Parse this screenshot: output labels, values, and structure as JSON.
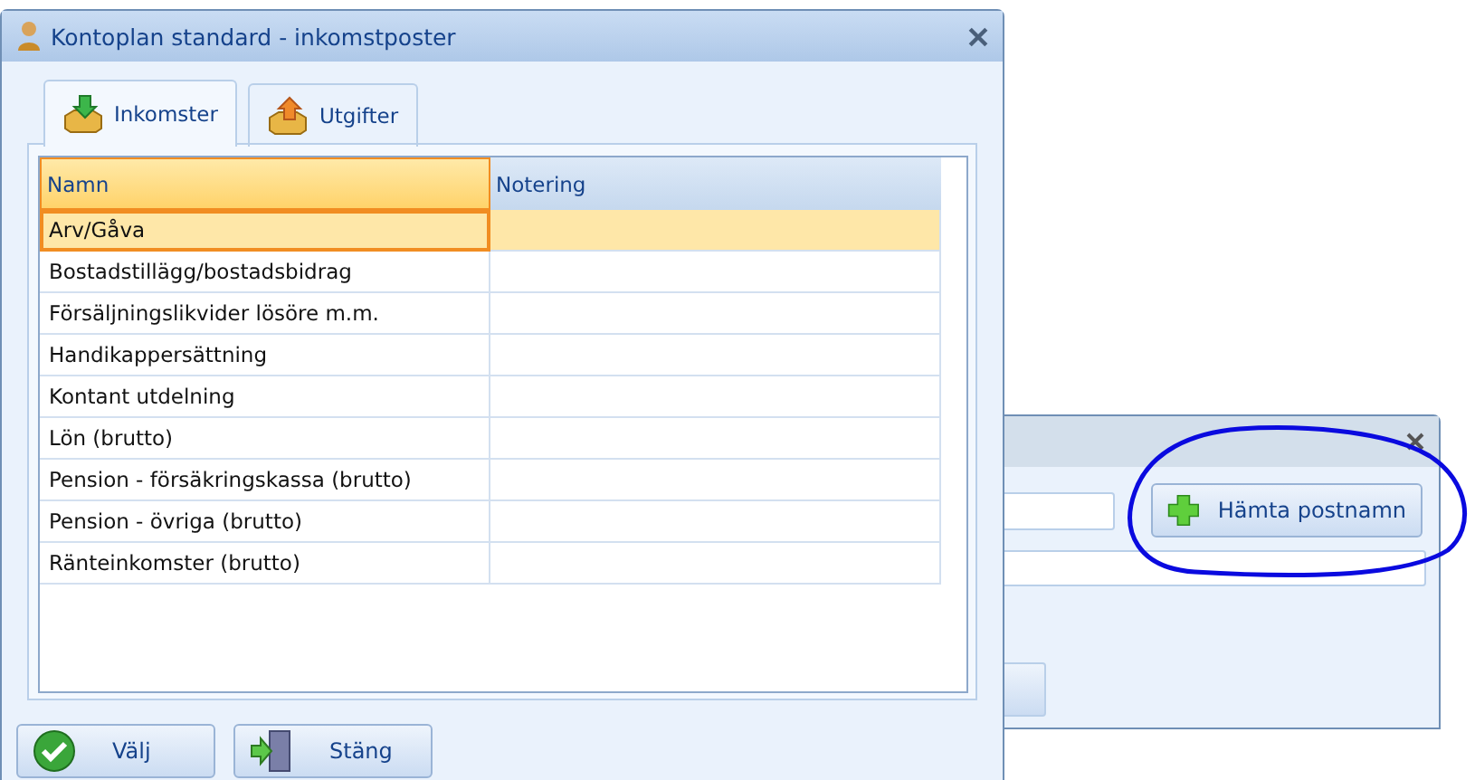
{
  "dialog": {
    "title": "Kontoplan standard - inkomstposter",
    "tabs": [
      {
        "label": "Inkomster",
        "kind": "income",
        "selected": true
      },
      {
        "label": "Utgifter",
        "kind": "expense",
        "selected": false
      }
    ],
    "table": {
      "columns": [
        "Namn",
        "Notering"
      ],
      "rows": [
        {
          "name": "Arv/Gåva",
          "selected": true
        },
        {
          "name": "Bostadstillägg/bostadsbidrag",
          "selected": false
        },
        {
          "name": "Försäljningslikvider lösöre m.m.",
          "selected": false
        },
        {
          "name": "Handikappersättning",
          "selected": false
        },
        {
          "name": "Kontant utdelning",
          "selected": false
        },
        {
          "name": "Lön (brutto)",
          "selected": false
        },
        {
          "name": "Pension - försäkringskassa (brutto)",
          "selected": false
        },
        {
          "name": "Pension - övriga (brutto)",
          "selected": false
        },
        {
          "name": "Ränteinkomster (brutto)",
          "selected": false
        }
      ]
    },
    "buttons": [
      {
        "label": "Välj",
        "kind": "ok"
      },
      {
        "label": "Stäng",
        "kind": "close"
      }
    ]
  },
  "background_window": {
    "button": {
      "label": "Hämta postnamn"
    }
  }
}
